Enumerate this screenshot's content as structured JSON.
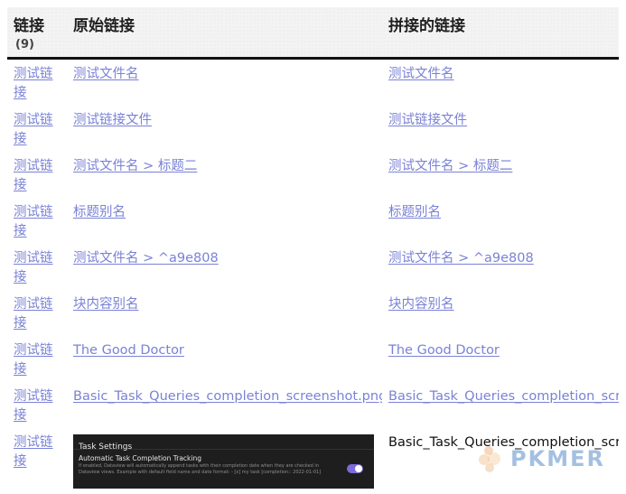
{
  "header": {
    "col_link": "链接",
    "col_count": "(9)",
    "col_original": "原始链接",
    "col_joined": "拼接的链接"
  },
  "rows": [
    {
      "link": "测试链接",
      "original": "测试文件名",
      "joined": "测试文件名"
    },
    {
      "link": "测试链接",
      "original": "测试链接文件",
      "joined": "测试链接文件"
    },
    {
      "link": "测试链接",
      "original": "测试文件名 > 标题二",
      "joined": "测试文件名 > 标题二"
    },
    {
      "link": "测试链接",
      "original": "标题别名",
      "joined": "标题别名"
    },
    {
      "link": "测试链接",
      "original": "测试文件名 > ^a9e808",
      "joined": "测试文件名 > ^a9e808"
    },
    {
      "link": "测试链接",
      "original": "块内容别名",
      "joined": "块内容别名"
    },
    {
      "link": "测试链接",
      "original": "The Good Doctor",
      "joined": "The Good Doctor"
    },
    {
      "link": "测试链接",
      "original": "Basic_Task_Queries_completion_screenshot.png",
      "joined": "Basic_Task_Queries_completion_scre"
    },
    {
      "link": "测试链接",
      "joined": "Basic_Task_Queries_completion_scre"
    }
  ],
  "embedded_image": {
    "title": "Task Settings",
    "setting_name": "Automatic Task Completion Tracking",
    "setting_desc": "If enabled, Dataview will automatically append tasks with their completion date when they are checked in Dataview views. Example with default field name and date format: - [x] my task [completion:: 2022-01-01]",
    "toggle_on": true,
    "toggle_color": "#7b6cd9"
  },
  "watermark": {
    "text": "PKMER"
  },
  "colors": {
    "link": "#7a82d6",
    "header_rule": "#111111"
  }
}
